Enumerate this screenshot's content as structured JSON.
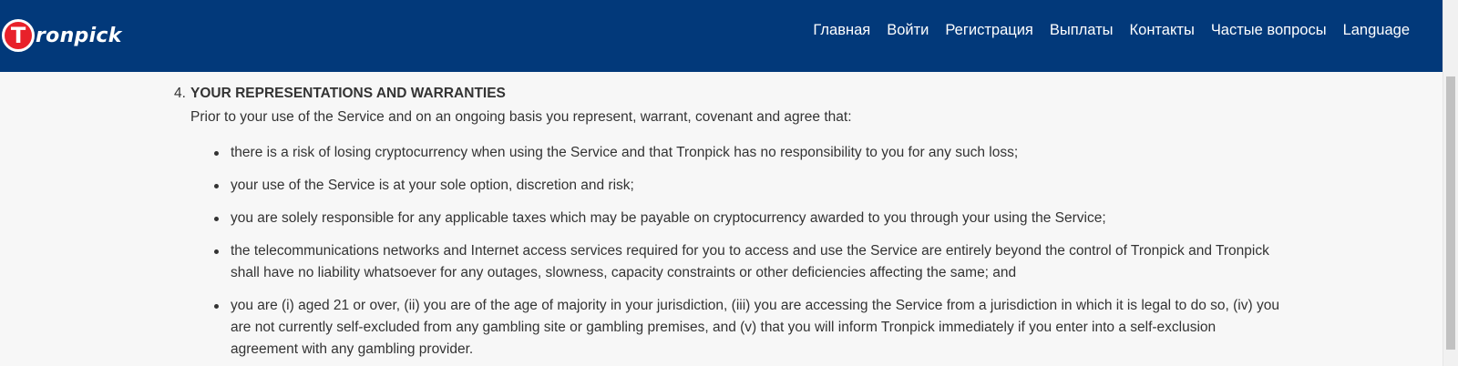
{
  "brand": {
    "logo_letter": "T",
    "logo_text": "ronpick",
    "colors": {
      "header_bg": "#02397a",
      "logo_red": "#e8212a",
      "text": "#333333",
      "page_bg": "#f7f7f7"
    }
  },
  "nav": {
    "items": [
      {
        "label": "Главная"
      },
      {
        "label": "Войти"
      },
      {
        "label": "Регистрация"
      },
      {
        "label": "Выплаты"
      },
      {
        "label": "Контакты"
      },
      {
        "label": "Частые вопросы"
      },
      {
        "label": "Language"
      }
    ]
  },
  "section": {
    "number": "4.",
    "title": "YOUR REPRESENTATIONS AND WARRANTIES",
    "intro": "Prior to your use of the Service and on an ongoing basis you represent, warrant, covenant and agree that:",
    "items": [
      {
        "text": "there is a risk of losing cryptocurrency when using the Service and that Tronpick has no responsibility to you for any such loss;"
      },
      {
        "text": "your use of the Service is at your sole option, discretion and risk;"
      },
      {
        "text": "you are solely responsible for any applicable taxes which may be payable on cryptocurrency awarded to you through your using the Service;"
      },
      {
        "text": "the telecommunications networks and Internet access services required for you to access and use the Service are entirely beyond the control of Tronpick and Tronpick shall have no liability whatsoever for any outages, slowness, capacity constraints or other deficiencies affecting the same; and"
      },
      {
        "text": "you are (i) aged 21 or over, (ii) you are of the age of majority in your jurisdiction, (iii) you are accessing the Service from a jurisdiction in which it is legal to do so, (iv) you are not currently self-excluded from any gambling site or gambling premises, and (v) that you will inform Tronpick immediately if you enter into a self-exclusion agreement with any gambling provider."
      }
    ]
  }
}
